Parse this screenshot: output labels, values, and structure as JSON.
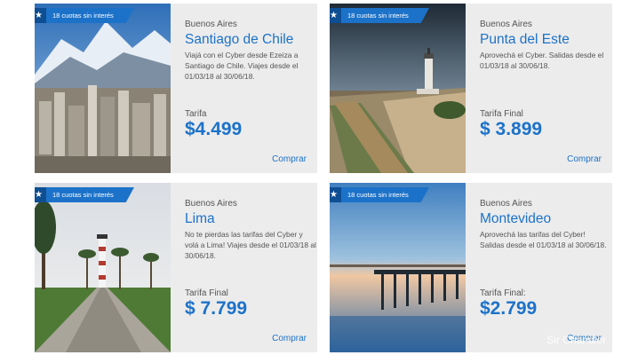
{
  "cards": [
    {
      "badge": "18 cuotas sin interés",
      "origin": "Buenos Aires",
      "destination": "Santiago de Chile",
      "description": "Viajá con el Cyber desde Ezeiza a Santiago de Chile. Viajes desde el 01/03/18 al 30/06/18.",
      "price_label": "Tarifa",
      "price": "$4.499",
      "buy_label": "Comprar"
    },
    {
      "badge": "18 cuotas sin interés",
      "origin": "Buenos Aires",
      "destination": "Punta del Este",
      "description": "Aprovechá el Cyber. Salidas desde el 01/03/18 al 30/06/18.",
      "price_label": "Tarifa Final",
      "price": "$ 3.899",
      "buy_label": "Comprar"
    },
    {
      "badge": "18 cuotas sin interés",
      "origin": "Buenos Aires",
      "destination": "Lima",
      "description": "No te pierdas las tarifas del Cyber y volá a Lima! Viajes desde el 01/03/18 al 30/06/18.",
      "price_label": "Tarifa Final",
      "price": "$ 7.799",
      "buy_label": "Comprar"
    },
    {
      "badge": "18 cuotas sin interés",
      "origin": "Buenos Aires",
      "destination": "Montevideo",
      "description": "Aprovechá las tarifas del Cyber! Salidas desde el 01/03/18 al 30/06/18.",
      "price_label": "Tarifa Final:",
      "price": "$2.799",
      "buy_label": "Comprar"
    }
  ],
  "watermark": "Sir Chandler",
  "colors": {
    "accent": "#1c72c9",
    "card_bg": "#ececec",
    "ribbon_star": "#0e4e93"
  },
  "icons": {
    "badge_icon": "star-icon"
  }
}
